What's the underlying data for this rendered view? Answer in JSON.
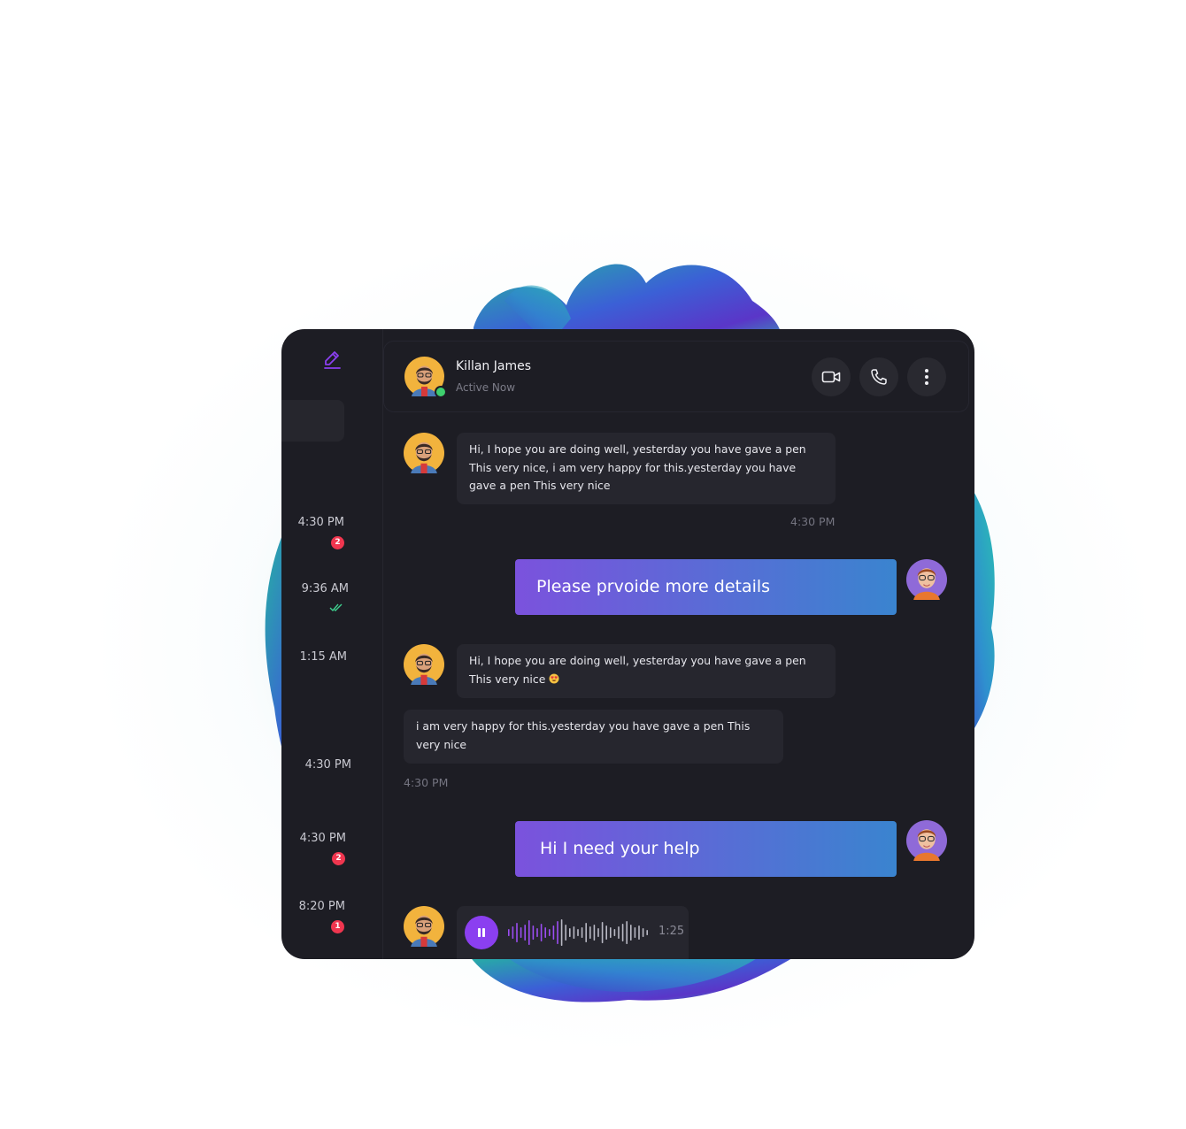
{
  "colors": {
    "accent": "#8b3ff0",
    "bubble_gradient_start": "#7b52dd",
    "bubble_gradient_end": "#3a84cf",
    "unread_badge": "#f0364f",
    "online": "#3ecf6e",
    "read_check": "#3ecf8e",
    "window_bg": "#1d1d24"
  },
  "sidebar": {
    "compose_icon": "pencil-edit-icon",
    "conversations": [
      {
        "time": "4:30 PM",
        "unread": "2"
      },
      {
        "time": "9:36 AM",
        "status_icon": "double-check-icon"
      },
      {
        "time": "1:15 AM"
      },
      {
        "time": "4:30 PM"
      },
      {
        "time": "4:30 PM",
        "unread": "2"
      },
      {
        "time": "8:20 PM",
        "unread": "1"
      }
    ]
  },
  "header": {
    "name": "Killan James",
    "status": "Active Now",
    "actions": [
      "video-camera-icon",
      "phone-icon",
      "more-vertical-icon"
    ]
  },
  "messages": {
    "m1": {
      "text": "Hi, I hope you are doing well, yesterday you have gave a pen This very nice, i am very happy for this.yesterday you have gave a pen This very nice",
      "time": "4:30 PM"
    },
    "m2": {
      "text": "Please prvoide more details"
    },
    "m3": {
      "text": "Hi, I hope you are doing well, yesterday you have gave a pen This very nice",
      "emoji": "heart-eyes-emoji-icon"
    },
    "m4": {
      "text": " i am very happy for this.yesterday you have gave a pen This very nice",
      "time": "4:30 PM"
    },
    "m5": {
      "text": "Hi I need your help"
    },
    "voice": {
      "duration": "1:25",
      "state_icon": "pause-icon"
    }
  }
}
